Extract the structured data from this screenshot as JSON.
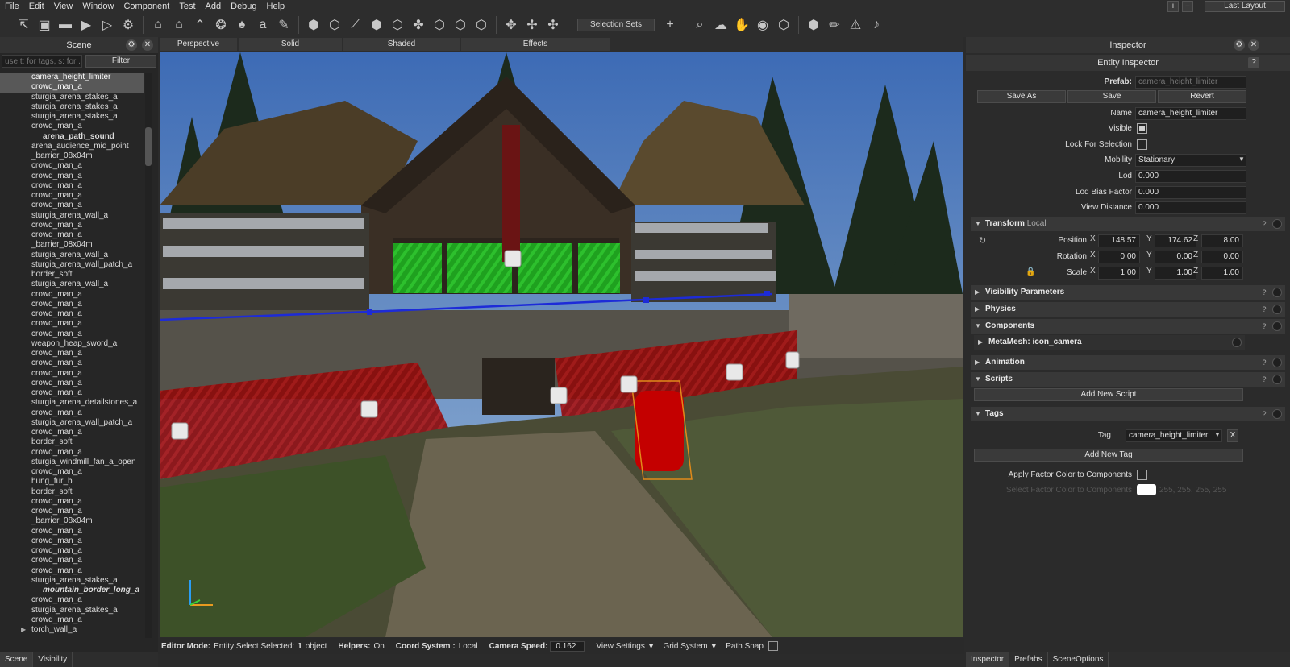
{
  "menubar": {
    "items": [
      "File",
      "Edit",
      "View",
      "Window",
      "Component",
      "Test",
      "Add",
      "Debug",
      "Help"
    ],
    "plus": "+",
    "minus": "−",
    "layout": "Last Layout"
  },
  "toolbar": {
    "selection_sets": "Selection Sets",
    "add": "+"
  },
  "scene": {
    "title": "Scene",
    "search_placeholder": "use t: for tags, s: for ...",
    "filter": "Filter",
    "tabs": [
      "Scene",
      "Visibility"
    ],
    "rows": [
      "camera_height_limiter",
      "crowd_man_a",
      "sturgia_arena_stakes_a",
      "sturgia_arena_stakes_a",
      "sturgia_arena_stakes_a",
      "crowd_man_a",
      "arena_path_sound",
      "arena_audience_mid_point",
      "_barrier_08x04m",
      "crowd_man_a",
      "crowd_man_a",
      "crowd_man_a",
      "crowd_man_a",
      "crowd_man_a",
      "sturgia_arena_wall_a",
      "crowd_man_a",
      "crowd_man_a",
      "_barrier_08x04m",
      "sturgia_arena_wall_a",
      "sturgia_arena_wall_patch_a",
      "border_soft",
      "sturgia_arena_wall_a",
      "crowd_man_a",
      "crowd_man_a",
      "crowd_man_a",
      "crowd_man_a",
      "crowd_man_a",
      "weapon_heap_sword_a",
      "crowd_man_a",
      "crowd_man_a",
      "crowd_man_a",
      "crowd_man_a",
      "crowd_man_a",
      "sturgia_arena_detailstones_a",
      "crowd_man_a",
      "sturgia_arena_wall_patch_a",
      "crowd_man_a",
      "border_soft",
      "crowd_man_a",
      "sturgia_windmill_fan_a_open",
      "crowd_man_a",
      "hung_fur_b",
      "border_soft",
      "crowd_man_a",
      "crowd_man_a",
      "_barrier_08x04m",
      "crowd_man_a",
      "crowd_man_a",
      "crowd_man_a",
      "crowd_man_a",
      "crowd_man_a",
      "sturgia_arena_stakes_a",
      "mountain_border_long_a",
      "crowd_man_a",
      "sturgia_arena_stakes_a",
      "crowd_man_a",
      "torch_wall_a"
    ]
  },
  "viewport": {
    "tabs": [
      "Perspective",
      "Solid",
      "Shaded",
      "Effects"
    ]
  },
  "status": {
    "editor_mode_label": "Editor Mode:",
    "editor_mode_value": "Entity Select Selected:",
    "selected_count": "1",
    "selected_suffix": "object",
    "helpers_label": "Helpers:",
    "helpers_value": "On",
    "coord_label": "Coord System :",
    "coord_value": "Local",
    "camera_speed_label": "Camera Speed:",
    "camera_speed_value": "0.162",
    "view_settings": "View Settings ▼",
    "grid_system": "Grid System ▼",
    "path_snap": "Path Snap"
  },
  "inspector": {
    "title": "Inspector",
    "subtitle": "Entity Inspector",
    "help": "?",
    "prefab_label": "Prefab:",
    "prefab_value": "camera_height_limiter",
    "save_as": "Save As",
    "save": "Save",
    "revert": "Revert",
    "name_label": "Name",
    "name_value": "camera_height_limiter",
    "visible_label": "Visible",
    "lock_label": "Lock For Selection",
    "mobility_label": "Mobility",
    "mobility_value": "Stationary",
    "lod_label": "Lod",
    "lod_value": "0.000",
    "lod_bias_label": "Lod Bias Factor",
    "lod_bias_value": "0.000",
    "view_distance_label": "View Distance",
    "view_distance_value": "0.000",
    "transform_title": "Transform",
    "transform_space": "Local",
    "position_label": "Position",
    "position": [
      "148.57",
      "174.62",
      "8.00"
    ],
    "rotation_label": "Rotation",
    "rotation": [
      "0.00",
      "0.00",
      "0.00"
    ],
    "scale_label": "Scale",
    "scale": [
      "1.00",
      "1.00",
      "1.00"
    ],
    "axis_x": "X",
    "axis_y": "Y",
    "axis_z": "Z",
    "visibility_params": "Visibility Parameters",
    "physics": "Physics",
    "components": "Components",
    "metamesh": "MetaMesh: icon_camera",
    "animation": "Animation",
    "scripts": "Scripts",
    "add_script": "Add New Script",
    "tags": "Tags",
    "tag_label": "Tag",
    "tag_value": "camera_height_limiter",
    "tag_remove": "X",
    "add_tag": "Add New Tag",
    "apply_factor": "Apply Factor Color to Components",
    "select_factor": "Select Factor Color to Components",
    "factor_value": "255, 255, 255, 255",
    "tabs": [
      "Inspector",
      "Prefabs",
      "SceneOptions"
    ]
  }
}
